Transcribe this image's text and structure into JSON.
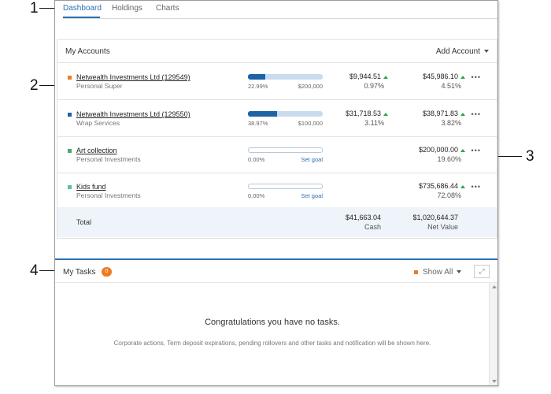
{
  "callouts": [
    "1",
    "2",
    "3",
    "4"
  ],
  "tabs": [
    {
      "label": "Dashboard",
      "active": true
    },
    {
      "label": "Holdings",
      "active": false
    },
    {
      "label": "Charts",
      "active": false
    }
  ],
  "accounts": {
    "title": "My Accounts",
    "add_account": "Add Account",
    "rows": [
      {
        "name": "Netwealth Investments Ltd (129549)",
        "sub": "Personal Super",
        "color": "#f07b1f",
        "progress": 0.2299,
        "pct": "22.99%",
        "goal": "$200,000",
        "cash": "$9,944.51",
        "cash_pct": "0.97%",
        "net": "$45,986.10",
        "net_pct": "4.51%"
      },
      {
        "name": "Netwealth Investments Ltd (129550)",
        "sub": "Wrap Services",
        "color": "#1f63a7",
        "progress": 0.3897,
        "pct": "38.97%",
        "goal": "$100,000",
        "cash": "$31,718.53",
        "cash_pct": "3.11%",
        "net": "$38,971.83",
        "net_pct": "3.82%"
      },
      {
        "name": "Art collection",
        "sub": "Personal Investments",
        "color": "#4aa86b",
        "progress": 0,
        "pct": "0.00%",
        "goal": "Set goal",
        "cash": "",
        "cash_pct": "",
        "net": "$200,000.00",
        "net_pct": "19.60%"
      },
      {
        "name": "Kids fund",
        "sub": "Personal Investments",
        "color": "#5bbfa0",
        "progress": 0,
        "pct": "0.00%",
        "goal": "Set goal",
        "cash": "",
        "cash_pct": "",
        "net": "$735,686.44",
        "net_pct": "72.08%"
      }
    ],
    "total": {
      "label": "Total",
      "cash": "$41,663.04",
      "cash_label": "Cash",
      "net": "$1,020,644.37",
      "net_label": "Net Value"
    }
  },
  "tasks": {
    "title": "My Tasks",
    "count": "0",
    "show_all": "Show All",
    "expand_icon": "⤢",
    "empty_title": "Congratulations you have no tasks.",
    "empty_desc": "Corporate actions, Term deposit expirations, pending rollovers and other tasks and notification will be shown here."
  },
  "more_icon": "•••"
}
